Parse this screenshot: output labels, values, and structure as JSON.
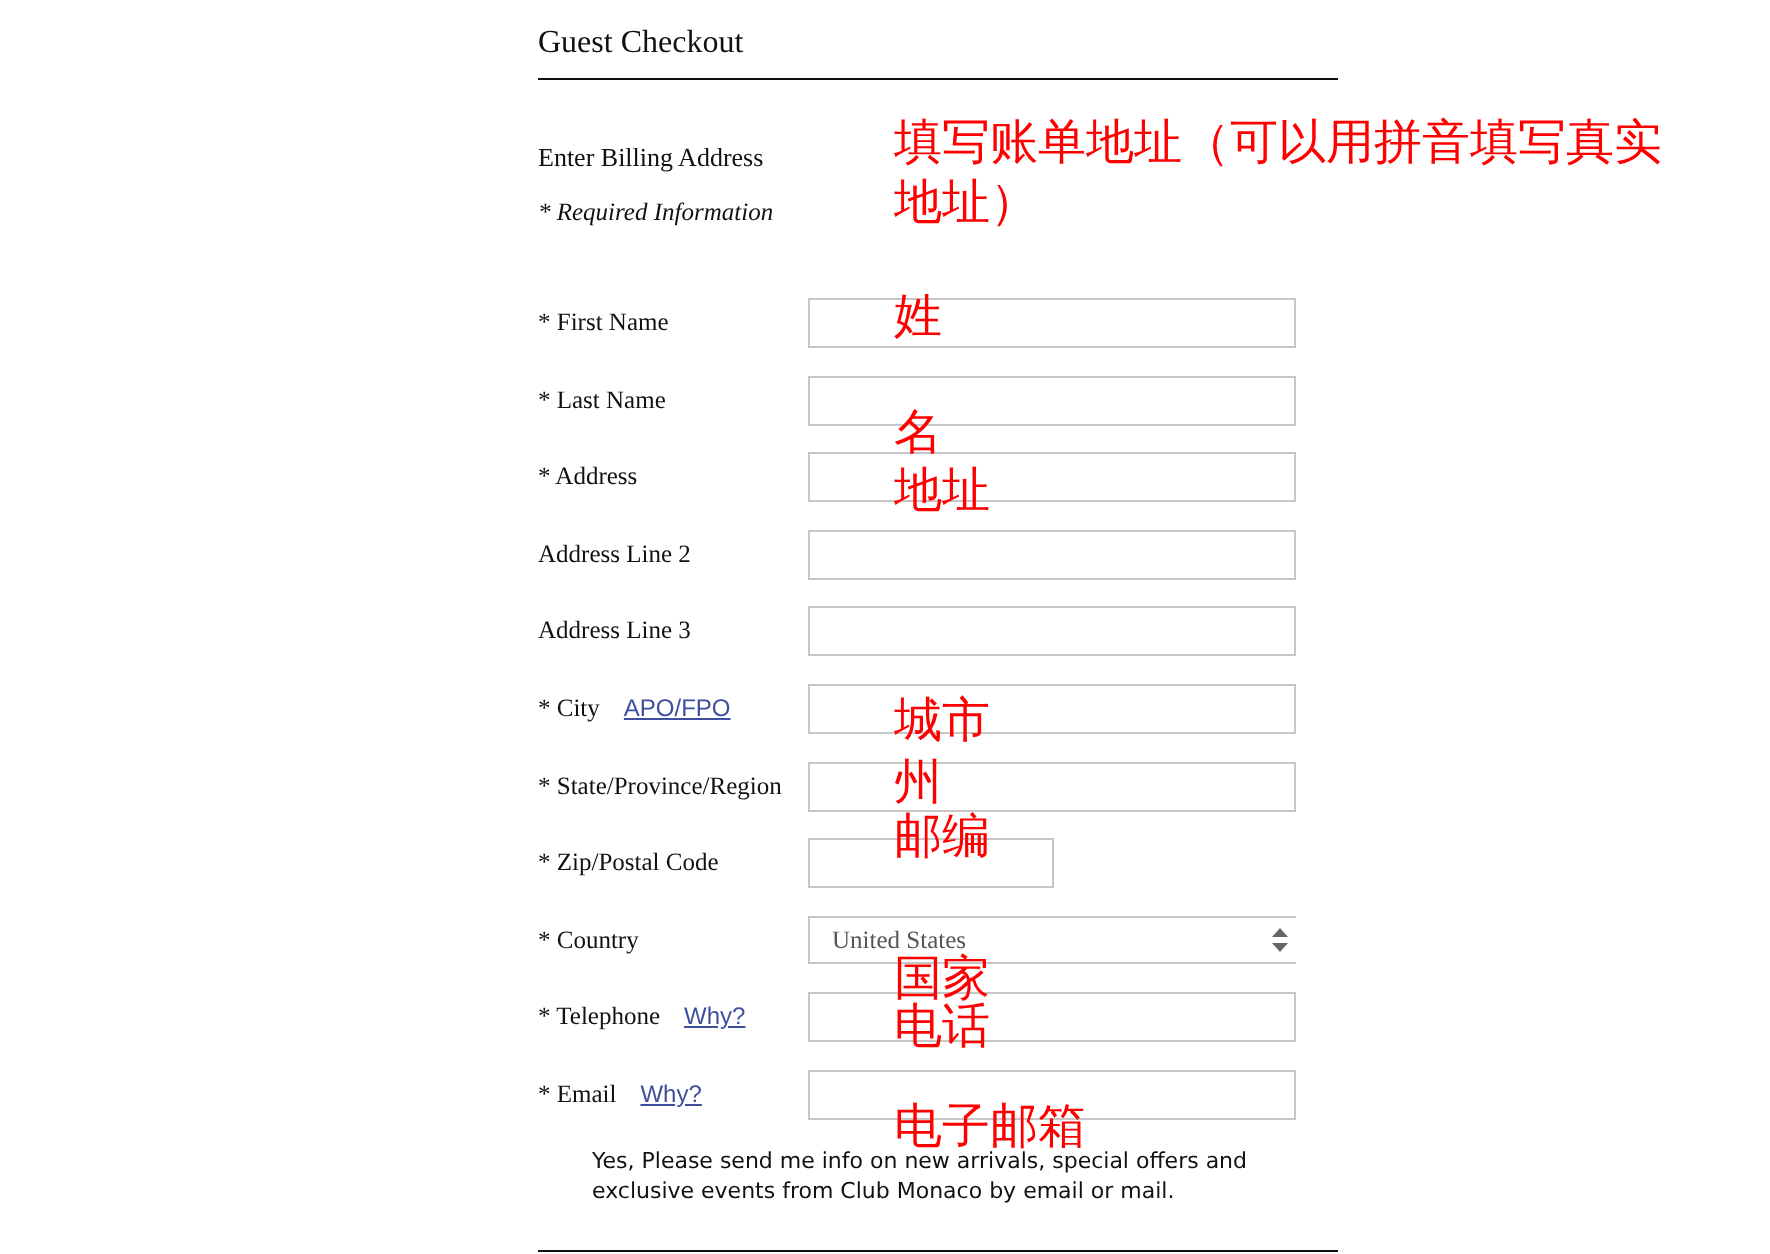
{
  "checkout": {
    "title": "Guest Checkout"
  },
  "billing": {
    "heading": "Enter Billing Address",
    "required_note": "* Required Information",
    "annotation": "填写账单地址（可以用拼音填写真实地址）"
  },
  "fields": [
    {
      "kind": "text",
      "label": "* First Name",
      "annotation": "姓"
    },
    {
      "kind": "text",
      "label": "* Last Name",
      "annotation": "名"
    },
    {
      "kind": "text",
      "label": "* Address",
      "annotation": "地址"
    },
    {
      "kind": "text",
      "label": "Address Line 2"
    },
    {
      "kind": "text",
      "label": "Address Line 3"
    },
    {
      "kind": "text",
      "label": "* City",
      "link": "APO/FPO",
      "annotation": "城市"
    },
    {
      "kind": "text",
      "label": "* State/Province/Region",
      "annotation": "州"
    },
    {
      "kind": "short-text",
      "label": "* Zip/Postal Code",
      "annotation": "邮编"
    },
    {
      "kind": "select",
      "label": "* Country",
      "value": "United States",
      "annotation": "国家"
    },
    {
      "kind": "text",
      "label": "* Telephone",
      "link": "Why?",
      "annotation": "电话"
    },
    {
      "kind": "text",
      "label": "* Email",
      "link": "Why?",
      "annotation": "电子邮箱"
    }
  ],
  "newsletter": {
    "text": "Yes, Please send me info on new arrivals, special offers and exclusive events from Club Monaco by email or mail."
  }
}
